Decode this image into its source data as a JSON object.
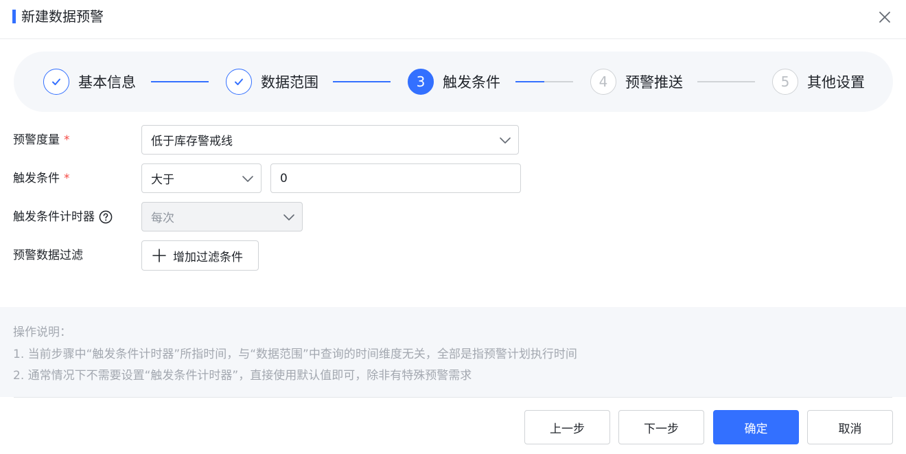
{
  "dialog": {
    "title": "新建数据预警"
  },
  "steps": [
    {
      "number": "1",
      "label": "基本信息",
      "status": "done"
    },
    {
      "number": "2",
      "label": "数据范围",
      "status": "done"
    },
    {
      "number": "3",
      "label": "触发条件",
      "status": "active"
    },
    {
      "number": "4",
      "label": "预警推送",
      "status": "todo"
    },
    {
      "number": "5",
      "label": "其他设置",
      "status": "todo"
    }
  ],
  "form": {
    "metric": {
      "label": "预警度量",
      "required_mark": "*",
      "value": "低于库存警戒线"
    },
    "condition": {
      "label": "触发条件",
      "required_mark": "*",
      "operator": "大于",
      "value": "0"
    },
    "timer": {
      "label": "触发条件计时器",
      "value": "每次"
    },
    "filter": {
      "label": "预警数据过滤",
      "button_label": "增加过滤条件"
    }
  },
  "instructions": {
    "heading": "操作说明：",
    "line1": "1. 当前步骤中“触发条件计时器”所指时间，与“数据范围”中查询的时间维度无关，全部是指预警计划执行时间",
    "line2": "2. 通常情况下不需要设置“触发条件计时器”，直接使用默认值即可，除非有特殊预警需求"
  },
  "footer": {
    "prev_label": "上一步",
    "next_label": "下一步",
    "confirm_label": "确定",
    "cancel_label": "取消"
  },
  "colors": {
    "accent": "#3370ff",
    "required": "#f54a45",
    "muted_text": "#a3a8b0"
  }
}
